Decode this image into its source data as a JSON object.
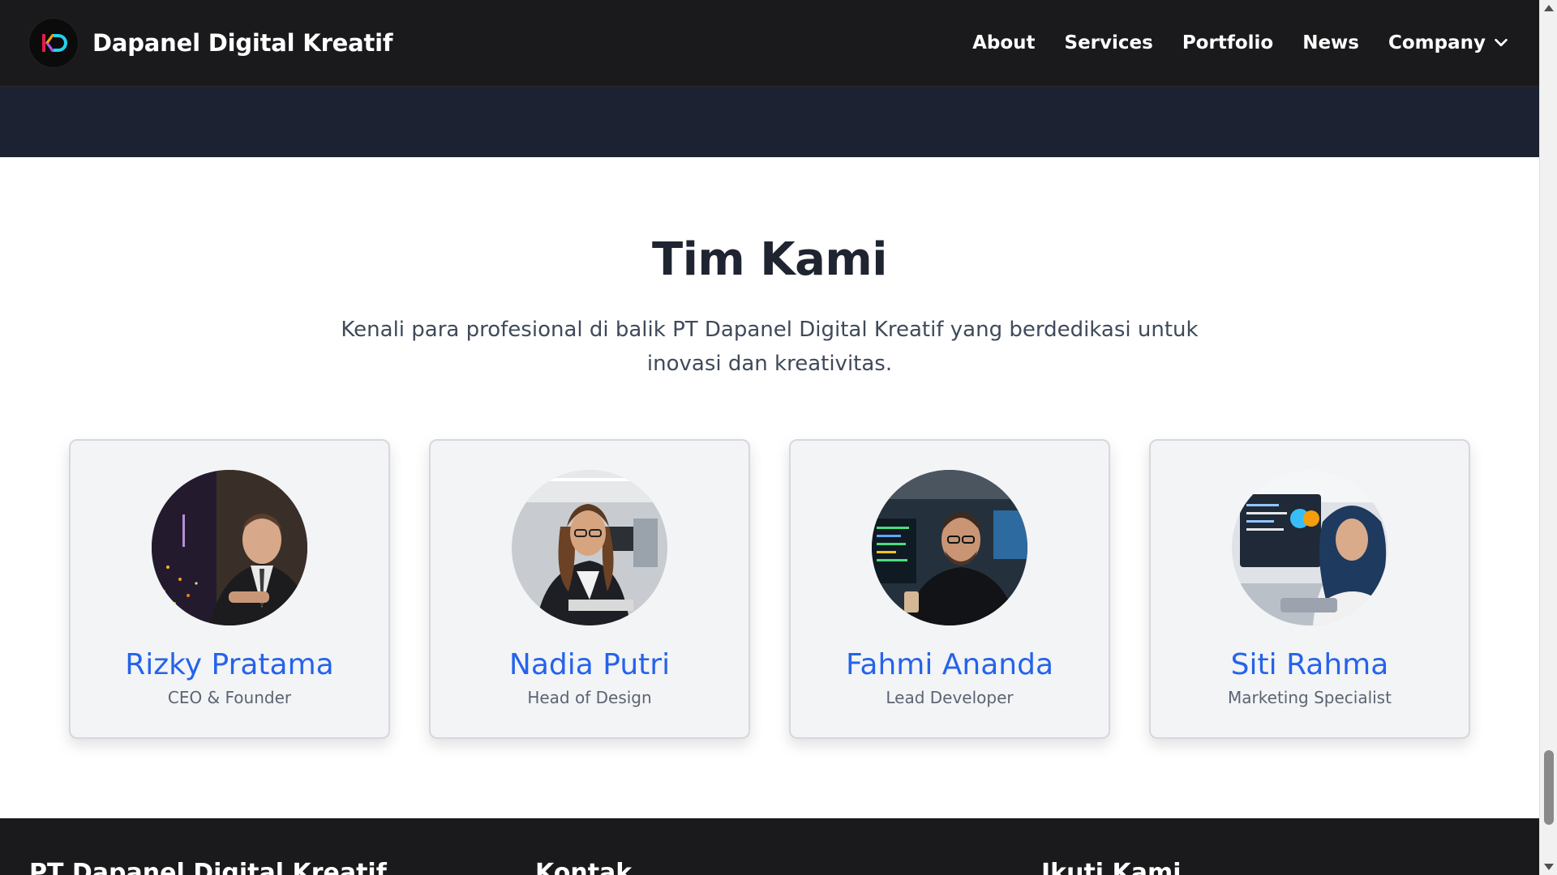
{
  "navbar": {
    "brand": "Dapanel Digital Kreatif",
    "links": [
      {
        "label": "About"
      },
      {
        "label": "Services"
      },
      {
        "label": "Portfolio"
      },
      {
        "label": "News"
      }
    ],
    "dropdown": {
      "label": "Company",
      "icon": "chevron-down-icon"
    }
  },
  "team": {
    "title": "Tim Kami",
    "subtitle": "Kenali para profesional di balik PT Dapanel Digital Kreatif yang berdedikasi untuk inovasi dan kreativitas.",
    "members": [
      {
        "name": "Rizky Pratama",
        "role": "CEO & Founder"
      },
      {
        "name": "Nadia Putri",
        "role": "Head of Design"
      },
      {
        "name": "Fahmi Ananda",
        "role": "Lead Developer"
      },
      {
        "name": "Siti Rahma",
        "role": "Marketing Specialist"
      }
    ]
  },
  "footer": {
    "col1": "PT Dapanel Digital Kreatif",
    "col2": "Kontak",
    "col3": "Ikuti Kami"
  },
  "colors": {
    "navbar_bg": "#1a1a1c",
    "hero_strip": "#1c2231",
    "accent": "#2563eb",
    "card_bg": "#f3f4f6"
  }
}
